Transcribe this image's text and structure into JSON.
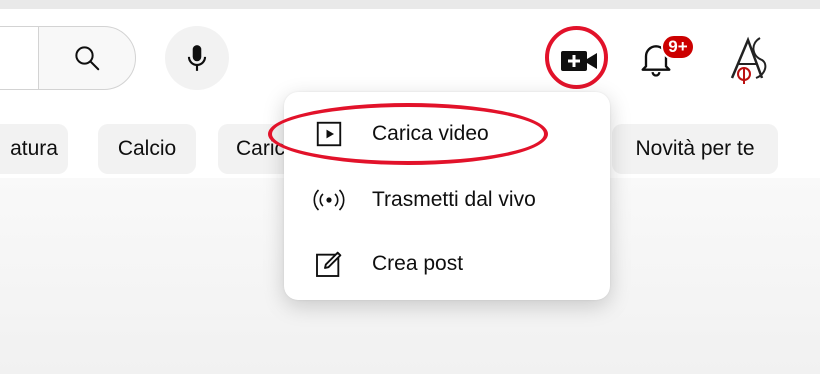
{
  "header": {
    "notifications_badge": "9+",
    "accent_color": "#e2122a",
    "badge_color": "#cc0000"
  },
  "chips": [
    {
      "label": "atura"
    },
    {
      "label": "Calcio"
    },
    {
      "label": "Caric"
    },
    {
      "label": "Novità per te"
    }
  ],
  "create_menu": {
    "items": [
      {
        "label": "Carica video",
        "icon": "play-square-icon"
      },
      {
        "label": "Trasmetti dal vivo",
        "icon": "broadcast-icon"
      },
      {
        "label": "Crea post",
        "icon": "edit-post-icon"
      }
    ]
  }
}
